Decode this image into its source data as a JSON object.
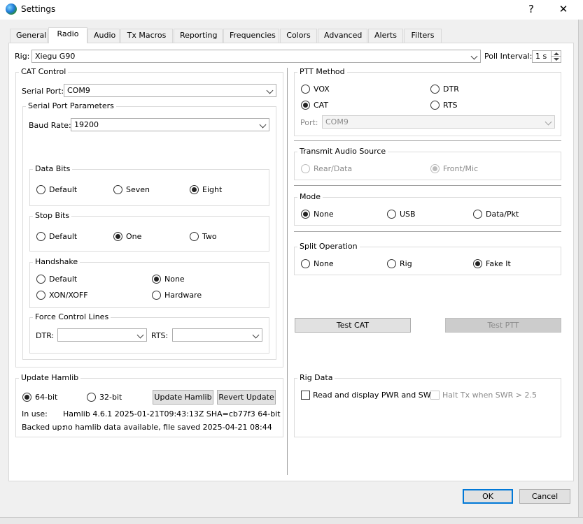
{
  "window": {
    "title": "Settings",
    "help": "?",
    "close": "✕"
  },
  "tabs": [
    "General",
    "Radio",
    "Audio",
    "Tx Macros",
    "Reporting",
    "Frequencies",
    "Colors",
    "Advanced",
    "Alerts",
    "Filters"
  ],
  "rig": {
    "label": "Rig:",
    "value": "Xiegu G90",
    "poll_label": "Poll Interval:",
    "poll_value": "1 s"
  },
  "cat": {
    "title": "CAT Control",
    "serial_label": "Serial Port:",
    "serial_value": "COM9",
    "spp_title": "Serial Port Parameters",
    "baud_label": "Baud Rate:",
    "baud_value": "19200",
    "data_bits": {
      "title": "Data Bits",
      "opts": [
        "Default",
        "Seven",
        "Eight"
      ]
    },
    "stop_bits": {
      "title": "Stop Bits",
      "opts": [
        "Default",
        "One",
        "Two"
      ]
    },
    "handshake": {
      "title": "Handshake",
      "opts": [
        "Default",
        "None",
        "XON/XOFF",
        "Hardware"
      ]
    },
    "force": {
      "title": "Force Control Lines",
      "dtr": "DTR:",
      "rts": "RTS:"
    }
  },
  "hamlib": {
    "title": "Update Hamlib",
    "bit64": "64-bit",
    "bit32": "32-bit",
    "update_btn": "Update Hamlib",
    "revert_btn": "Revert Update",
    "inuse_label": "In use:",
    "inuse_value": "Hamlib 4.6.1 2025-01-21T09:43:13Z SHA=cb77f3 64-bit",
    "backed_label": "Backed up:",
    "backed_value": "no hamlib data available, file saved 2025-04-21 08:44"
  },
  "ptt": {
    "title": "PTT Method",
    "opts": [
      "VOX",
      "DTR",
      "CAT",
      "RTS"
    ],
    "port_label": "Port:",
    "port_value": "COM9"
  },
  "tx_audio": {
    "title": "Transmit Audio Source",
    "opts": [
      "Rear/Data",
      "Front/Mic"
    ]
  },
  "mode": {
    "title": "Mode",
    "opts": [
      "None",
      "USB",
      "Data/Pkt"
    ]
  },
  "split": {
    "title": "Split Operation",
    "opts": [
      "None",
      "Rig",
      "Fake It"
    ]
  },
  "tests": {
    "cat": "Test CAT",
    "ptt": "Test PTT"
  },
  "rig_data": {
    "title": "Rig Data",
    "read": "Read and display PWR and SWR",
    "halt": "Halt Tx when SWR > 2.5"
  },
  "footer": {
    "ok": "OK",
    "cancel": "Cancel"
  }
}
